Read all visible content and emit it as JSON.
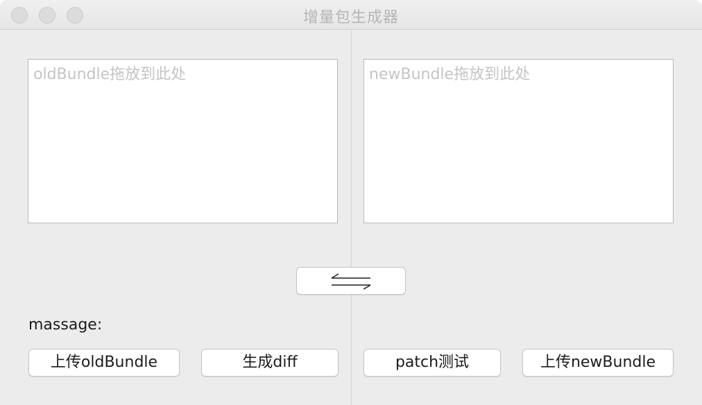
{
  "window": {
    "title": "增量包生成器"
  },
  "old_dropzone": {
    "placeholder": "oldBundle拖放到此处"
  },
  "new_dropzone": {
    "placeholder": "newBundle拖放到此处"
  },
  "swap_button": {
    "icon": "swap-arrows-icon"
  },
  "message": {
    "label": "massage:"
  },
  "buttons": {
    "upload_old": "上传oldBundle",
    "generate_diff": "生成diff",
    "patch_test": "patch测试",
    "upload_new": "上传newBundle"
  }
}
